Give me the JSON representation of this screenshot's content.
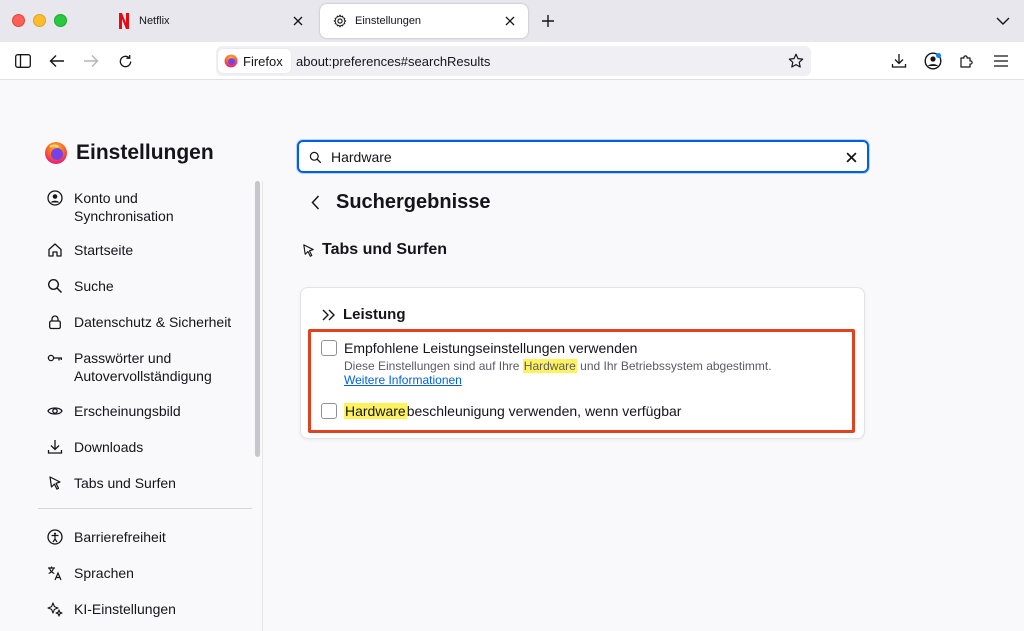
{
  "tabs": [
    {
      "title": "Netflix",
      "icon": "netflix-icon"
    },
    {
      "title": "Einstellungen",
      "icon": "gear-icon"
    }
  ],
  "urlbar": {
    "identity_label": "Firefox",
    "url": "about:preferences#searchResults"
  },
  "sidebar": {
    "title": "Einstellungen",
    "items": [
      {
        "label": "Konto und Synchronisation",
        "icon": "account-icon"
      },
      {
        "label": "Startseite",
        "icon": "home-icon"
      },
      {
        "label": "Suche",
        "icon": "search-icon"
      },
      {
        "label": "Datenschutz & Sicherheit",
        "icon": "lock-icon"
      },
      {
        "label": "Passwörter und Autovervollständigung",
        "icon": "key-icon"
      },
      {
        "label": "Erscheinungsbild",
        "icon": "eye-icon"
      },
      {
        "label": "Downloads",
        "icon": "download-icon"
      },
      {
        "label": "Tabs und Surfen",
        "icon": "tabs-icon"
      }
    ],
    "secondary_items": [
      {
        "label": "Barrierefreiheit",
        "icon": "accessibility-icon"
      },
      {
        "label": "Sprachen",
        "icon": "translate-icon"
      },
      {
        "label": "KI-Einstellungen",
        "icon": "ai-sparkle-icon"
      }
    ]
  },
  "search": {
    "value": "Hardware"
  },
  "results": {
    "heading": "Suchergebnisse",
    "section_title": "Tabs und Surfen",
    "card_title": "Leistung",
    "option1": {
      "label": "Empfohlene Leistungseinstellungen verwenden",
      "desc_before": "Diese Einstellungen sind auf Ihre ",
      "desc_highlight": "Hardware",
      "desc_after": " und Ihr Betriebssystem abgestimmt.",
      "link": "Weitere Informationen"
    },
    "option2": {
      "label_highlight": "Hardware",
      "label_after": "beschleunigung verwenden, wenn verfügbar"
    }
  },
  "colors": {
    "accent": "#0061e0",
    "highlight": "#fff35d",
    "annotation_box": "#e0421f"
  }
}
